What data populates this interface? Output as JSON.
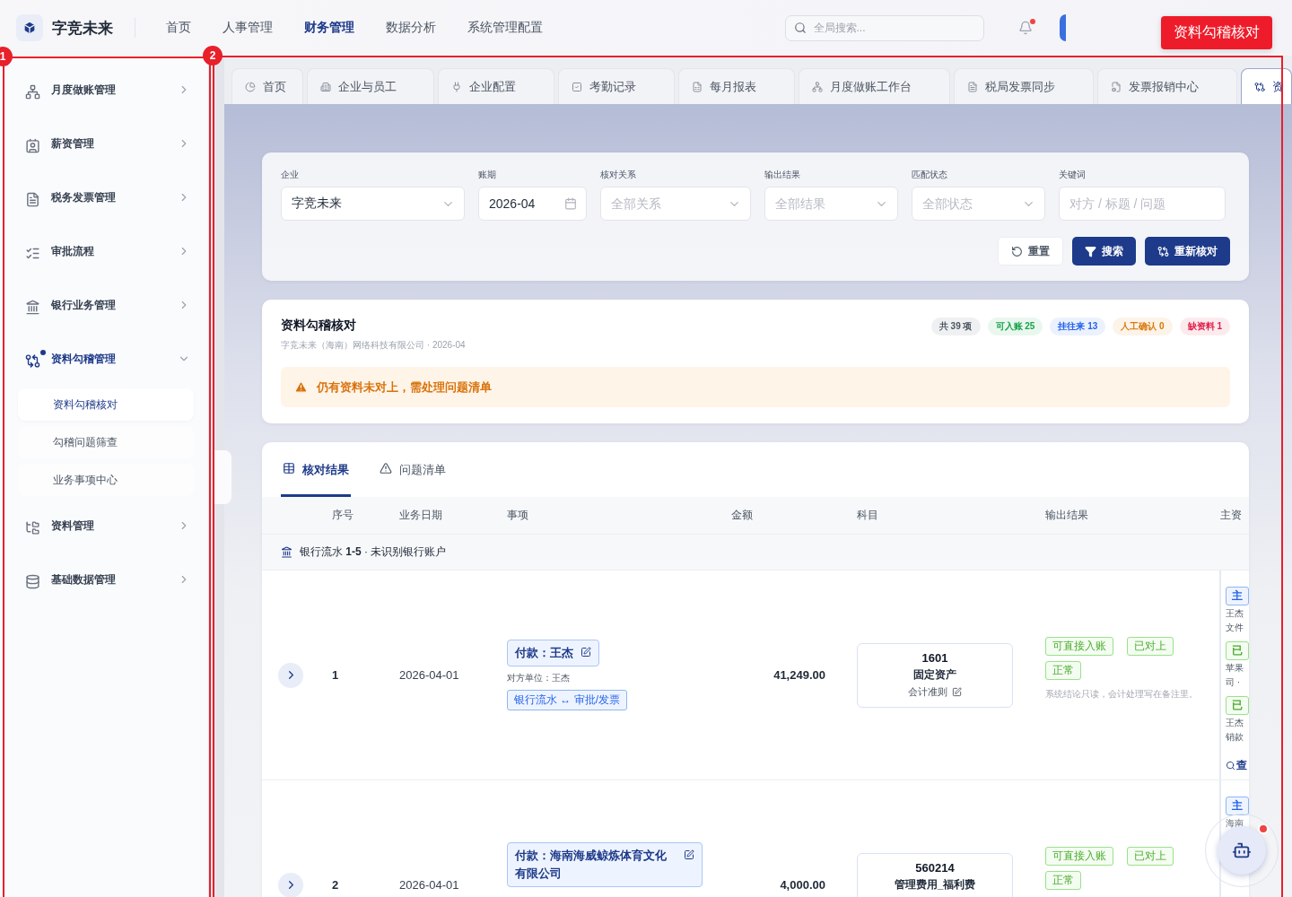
{
  "app": {
    "brand": "字竞未来"
  },
  "top_nav": [
    {
      "label": "首页",
      "selected": false
    },
    {
      "label": "人事管理",
      "selected": false
    },
    {
      "label": "财务管理",
      "selected": true
    },
    {
      "label": "数据分析",
      "selected": false
    },
    {
      "label": "系统管理配置",
      "selected": false
    }
  ],
  "search": {
    "placeholder": "全局搜索..."
  },
  "notifications": {
    "unread": true
  },
  "sidebar": {
    "items": [
      {
        "label": "月度做账管理",
        "expanded": false
      },
      {
        "label": "薪资管理",
        "expanded": false
      },
      {
        "label": "税务发票管理",
        "expanded": false
      },
      {
        "label": "审批流程",
        "expanded": false
      },
      {
        "label": "银行业务管理",
        "expanded": false
      },
      {
        "label": "资料勾稽管理",
        "expanded": true,
        "dot": true,
        "children": [
          {
            "label": "资料勾稽核对",
            "selected": true
          },
          {
            "label": "勾稽问题筛查",
            "selected": false
          },
          {
            "label": "业务事项中心",
            "selected": false
          }
        ]
      },
      {
        "label": "资料管理",
        "expanded": false
      },
      {
        "label": "基础数据管理",
        "expanded": false
      }
    ]
  },
  "tabs": [
    {
      "label": "首页",
      "selected": false
    },
    {
      "label": "企业与员工",
      "selected": false
    },
    {
      "label": "企业配置",
      "selected": false
    },
    {
      "label": "考勤记录",
      "selected": false
    },
    {
      "label": "每月报表",
      "selected": false
    },
    {
      "label": "月度做账工作台",
      "selected": false
    },
    {
      "label": "税局发票同步",
      "selected": false
    },
    {
      "label": "发票报销中心",
      "selected": false
    },
    {
      "label": "资",
      "selected": true
    }
  ],
  "filters": {
    "fields": [
      {
        "label": "企业",
        "kind": "select",
        "value": "字竞未来"
      },
      {
        "label": "账期",
        "kind": "date",
        "value": "2026-04"
      },
      {
        "label": "核对关系",
        "kind": "select",
        "placeholder": "全部关系"
      },
      {
        "label": "输出结果",
        "kind": "select",
        "placeholder": "全部结果"
      },
      {
        "label": "匹配状态",
        "kind": "select",
        "placeholder": "全部状态"
      },
      {
        "label": "关键词",
        "kind": "text",
        "placeholder": "对方 / 标题 / 问题"
      }
    ],
    "buttons": [
      {
        "label": "重置",
        "kind": "secondary"
      },
      {
        "label": "搜索",
        "kind": "primary"
      },
      {
        "label": "重新核对",
        "kind": "primary"
      }
    ]
  },
  "summary": {
    "title": "资料勾稽核对",
    "subtitle": "字竞未来（海南）网络科技有限公司 · 2026-04",
    "badges": [
      {
        "text": "共 39 项",
        "color": "#4b5563"
      },
      {
        "text": "可入账 25",
        "color": "#16a34a"
      },
      {
        "text": "挂往来 13",
        "color": "#2563eb"
      },
      {
        "text": "人工确认 0",
        "color": "#d97706"
      },
      {
        "text": "缺资料 1",
        "color": "#e11d48"
      }
    ],
    "alert": "仍有资料未对上，需处理问题清单"
  },
  "results": {
    "tabs": [
      {
        "label": "核对结果",
        "selected": true
      },
      {
        "label": "问题清单",
        "selected": false
      }
    ],
    "columns": [
      "序号",
      "业务日期",
      "事项",
      "金额",
      "科目",
      "输出结果",
      "主资"
    ],
    "group": "银行流水 **1-5** · 未识别银行账户",
    "rows": [
      {
        "seq": "1",
        "date": "2026-04-01",
        "item": {
          "title": "付款：王杰",
          "counterparty": "对方单位：王杰",
          "link": "银行流水 ↔ 审批/发票"
        },
        "amount": "41,249.00",
        "subject": {
          "code": "1601",
          "name": "固定资产",
          "standard": "会计准则"
        },
        "results": [
          "可直接入账",
          "已对上",
          "正常"
        ],
        "note": "系统结论只读，会计处理写在备注里。",
        "main_docs": [
          {
            "kind": "primary-tag",
            "text": "主"
          },
          {
            "kind": "note",
            "text": "王杰"
          },
          {
            "kind": "note",
            "text": "文件"
          },
          {
            "kind": "matched-tag",
            "text": "已"
          },
          {
            "kind": "note",
            "text": "苹果"
          },
          {
            "kind": "note",
            "text": "司 ·"
          },
          {
            "kind": "matched-tag",
            "text": "已"
          },
          {
            "kind": "note",
            "text": "王杰"
          },
          {
            "kind": "note",
            "text": "销款"
          },
          {
            "kind": "search-link",
            "text": "查"
          }
        ]
      },
      {
        "seq": "2",
        "date": "2026-04-01",
        "item": {
          "title": "付款：海南海威鲸炼体育文化有限公司"
        },
        "amount": "4,000.00",
        "subject": {
          "code": "560214",
          "name": "管理费用_福利费"
        },
        "results": [
          "可直接入账",
          "已对上",
          "正常"
        ],
        "main_docs": [
          {
            "kind": "primary-tag",
            "text": "主"
          },
          {
            "kind": "note",
            "text": "海南"
          }
        ]
      }
    ]
  },
  "assistant": {
    "unread": true
  },
  "annotations": {
    "boxes": [
      {
        "number": "1"
      },
      {
        "number": "2"
      }
    ],
    "callout": "资料勾稽核对"
  }
}
